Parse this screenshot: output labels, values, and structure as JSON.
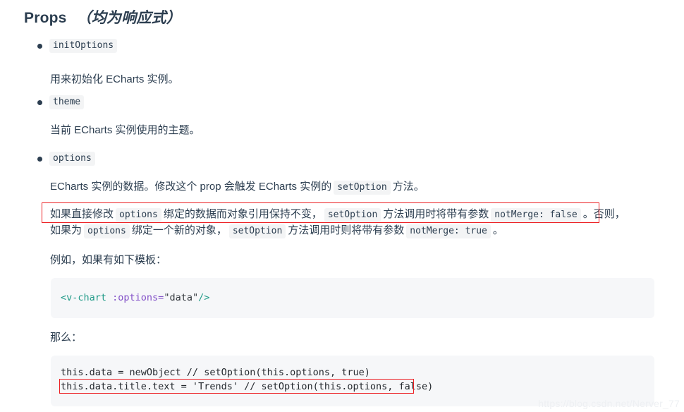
{
  "heading": {
    "title": "Props",
    "emphasis": "（均为响应式）"
  },
  "items": [
    {
      "name": "initOptions",
      "description": "用来初始化 ECharts 实例。"
    },
    {
      "name": "theme",
      "description": "当前 ECharts 实例使用的主题。"
    },
    {
      "name": "options",
      "description_parts": {
        "a": "ECharts 实例的数据。修改这个 prop 会触发 ECharts 实例的",
        "code": "setOption",
        "b": "方法。"
      }
    }
  ],
  "note": {
    "line1": {
      "a": "如果直接修改",
      "code1": "options",
      "b": "绑定的数据而对象引用保持不变，",
      "code2": "setOption",
      "c": "方法调用时将带有参数",
      "code3": "notMerge: false",
      "d": "。",
      "e": "否则，"
    },
    "line2": {
      "a": "如果为",
      "code1": "options",
      "b": "绑定一个新的对象，",
      "code2": "setOption",
      "c": "方法调用时则将带有参数",
      "code3": "notMerge: true",
      "d": "。"
    }
  },
  "example": {
    "lead": "例如，如果有如下模板：",
    "code": {
      "tag_open": "<v-chart",
      "attr": " :options=",
      "value": "\"data\"",
      "tag_close": "/>"
    }
  },
  "result": {
    "lead": "那么：",
    "line1": "this.data = newObject // setOption(this.options, true)",
    "line2": "this.data.title.text = 'Trends' // setOption(this.options, false)"
  },
  "watermark": "https://blog.csdn.net/Nerver_77",
  "colors": {
    "accent_red": "#ec2024",
    "text": "#2c3e50",
    "code_bg": "#f6f7f9",
    "inline_code_bg": "#f3f4f5"
  }
}
